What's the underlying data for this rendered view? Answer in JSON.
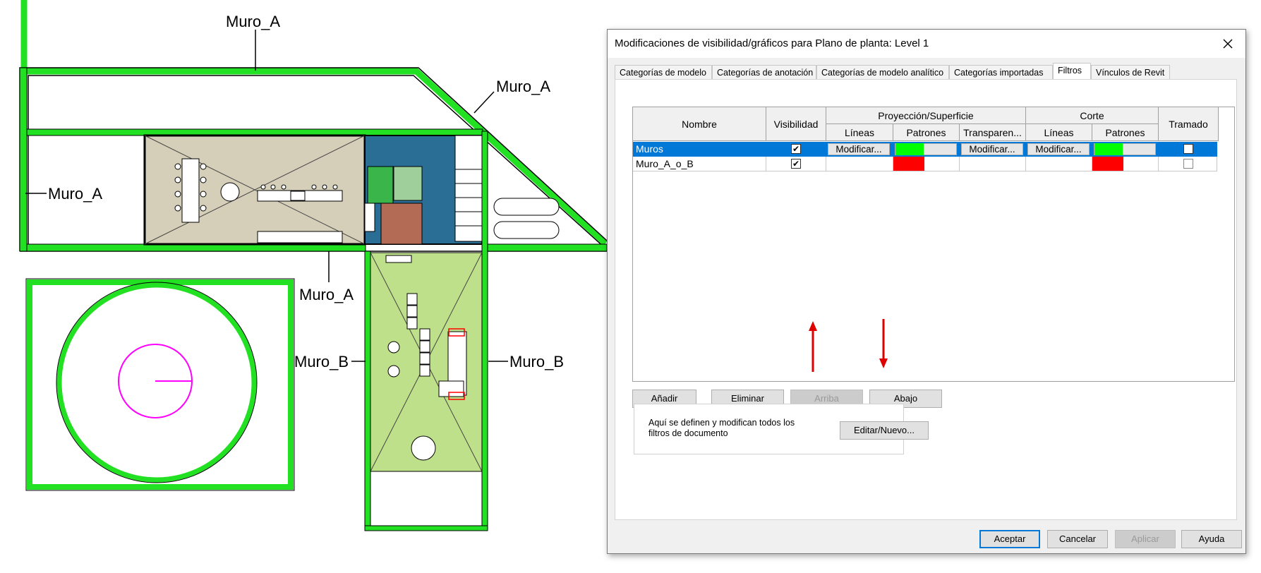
{
  "floor_plan": {
    "wall_labels": [
      "Muro_A",
      "Muro_A",
      "Muro_A",
      "Muro_A",
      "Muro_B",
      "Muro_B"
    ],
    "colors": {
      "wall_green": "#22e022",
      "annotation_red": "#ff0000",
      "circle_magenta": "#ff00ff",
      "room_beige": "#d5ceb8",
      "room_blue": "#2a6e96",
      "room_green": "#bfe08a"
    }
  },
  "dialog": {
    "title": "Modificaciones de visibilidad/gráficos para Plano de planta: Level 1",
    "tabs": [
      {
        "label": "Categorías de modelo",
        "active": false
      },
      {
        "label": "Categorías de anotación",
        "active": false
      },
      {
        "label": "Categorías de modelo analítico",
        "active": false
      },
      {
        "label": "Categorías importadas",
        "active": false
      },
      {
        "label": "Filtros",
        "active": true
      },
      {
        "label": "Vínculos de Revit",
        "active": false
      }
    ],
    "table": {
      "headers": {
        "name": "Nombre",
        "visibility": "Visibilidad",
        "projection_group": "Proyección/Superficie",
        "cut_group": "Corte",
        "halftone": "Tramado",
        "proj_lines": "Líneas",
        "proj_patterns": "Patrones",
        "proj_transparency": "Transparen...",
        "cut_lines": "Líneas",
        "cut_patterns": "Patrones"
      },
      "rows": [
        {
          "name": "Muros",
          "visible": true,
          "proj_lines": "Modificar...",
          "proj_pattern_color": "#00ff00",
          "proj_transparency": "Modificar...",
          "cut_lines": "Modificar...",
          "cut_pattern_color": "#00ff00",
          "halftone": false,
          "selected": true
        },
        {
          "name": "Muro_A_o_B",
          "visible": true,
          "proj_lines": "",
          "proj_pattern_color": "#ff0000",
          "proj_transparency": "",
          "cut_lines": "",
          "cut_pattern_color": "#ff0000",
          "halftone": false,
          "selected": false
        }
      ],
      "checkmark": "✔"
    },
    "buttons": {
      "add": "Añadir",
      "remove": "Eliminar",
      "up": "Arriba",
      "down": "Abajo",
      "edit_new": "Editar/Nuevo...",
      "ok": "Aceptar",
      "cancel": "Cancelar",
      "apply": "Aplicar",
      "help": "Ayuda"
    },
    "doc_filters_text": "Aquí se definen y modifican todos los filtros de documento",
    "colors": {
      "selection": "#0078d7",
      "arrow_red": "#e00000"
    }
  }
}
